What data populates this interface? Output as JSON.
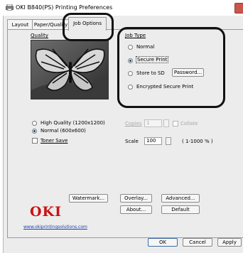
{
  "window": {
    "title": "OKI B840(PS) Printing Preferences"
  },
  "tabs": [
    {
      "label": "Layout"
    },
    {
      "label": "Paper/Quality"
    },
    {
      "label": "Job Options"
    }
  ],
  "quality": {
    "label": "Quality",
    "options": [
      {
        "label": "High Quality (1200x1200)",
        "selected": false
      },
      {
        "label": "Normal (600x600)",
        "selected": true
      }
    ],
    "toner_save": {
      "label": "Toner Save",
      "checked": false
    }
  },
  "job_type": {
    "label": "Job Type",
    "options": [
      {
        "label": "Normal",
        "selected": false
      },
      {
        "label": "Secure Print",
        "selected": true
      },
      {
        "label": "Store to SD",
        "selected": false
      },
      {
        "label": "Encrypted Secure Print",
        "selected": false
      }
    ],
    "password_button": "Password..."
  },
  "copies": {
    "label": "Copies",
    "value": "1",
    "collate_label": "Collate"
  },
  "scale": {
    "label": "Scale",
    "value": "100",
    "range": "( 1-1000 % )"
  },
  "buttons": {
    "watermark": "Watermark...",
    "overlay": "Overlay...",
    "advanced": "Advanced...",
    "about": "About...",
    "default": "Default",
    "ok": "OK",
    "cancel": "Cancel",
    "apply": "Apply"
  },
  "brand": {
    "logo": "OKI",
    "url": "www.okiprintingsolutions.com",
    "logo_color": "#cc1111"
  },
  "icons": {
    "title": "printer-icon",
    "close": "close-icon"
  }
}
